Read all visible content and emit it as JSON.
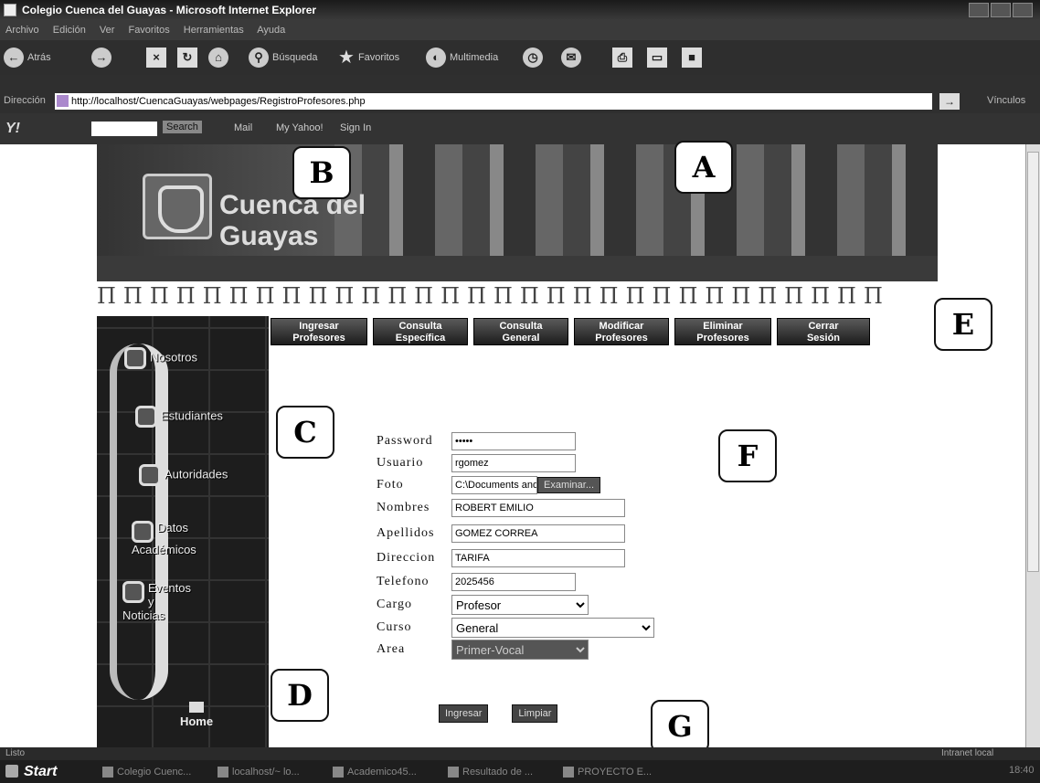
{
  "window": {
    "title": "Colegio Cuenca del Guayas - Microsoft Internet Explorer"
  },
  "menu": [
    "Archivo",
    "Edición",
    "Ver",
    "Favoritos",
    "Herramientas",
    "Ayuda"
  ],
  "toolbar": {
    "back": "Atrás",
    "search": "Búsqueda",
    "favorites": "Favoritos",
    "media": "Multimedia"
  },
  "address": {
    "label": "Dirección",
    "url": "http://localhost/CuencaGuayas/webpages/RegistroProfesores.php",
    "links": "Vínculos"
  },
  "yahoo": {
    "logo": "Y!",
    "search": "Search",
    "mail": "Mail",
    "my_yahoo": "My Yahoo!",
    "sign_in": "Sign In"
  },
  "banner": {
    "title_line1": "Cuenca del",
    "title_line2": "Guayas"
  },
  "ornaments": "ΠΠΠΠΠΠΠΠΠΠΠΠΠΠΠΠΠΠΠΠΠΠΠΠΠΠΠΠΠΠ",
  "nav": [
    {
      "l1": "Ingresar",
      "l2": "Profesores"
    },
    {
      "l1": "Consulta",
      "l2": "Específica"
    },
    {
      "l1": "Consulta",
      "l2": "General"
    },
    {
      "l1": "Modificar",
      "l2": "Profesores"
    },
    {
      "l1": "Eliminar",
      "l2": "Profesores"
    },
    {
      "l1": "Cerrar",
      "l2": "Sesión"
    }
  ],
  "sidebar": {
    "items": [
      {
        "label": "Nosotros"
      },
      {
        "label": "Estudiantes"
      },
      {
        "label": "Autoridades"
      },
      {
        "label1": "Datos",
        "label2": "Académicos"
      },
      {
        "label1": "Eventos",
        "label2": "y Noticias"
      }
    ],
    "home": "Home"
  },
  "form": {
    "password": {
      "label": "Password",
      "value": "•••••"
    },
    "usuario": {
      "label": "Usuario",
      "value": "rgomez"
    },
    "foto": {
      "label": "Foto",
      "value": "C:\\Documents and Setti",
      "browse": "Examinar..."
    },
    "nombres": {
      "label": "Nombres",
      "value": "ROBERT EMILIO"
    },
    "apellidos": {
      "label": "Apellidos",
      "value": "GOMEZ CORREA"
    },
    "direccion": {
      "label": "Direccion",
      "value": "TARIFA"
    },
    "telefono": {
      "label": "Telefono",
      "value": "2025456"
    },
    "cargo": {
      "label": "Cargo",
      "value": "Profesor"
    },
    "curso": {
      "label": "Curso",
      "value": "General"
    },
    "area": {
      "label": "Area",
      "value": "Primer-Vocal"
    },
    "ingresar": "Ingresar",
    "limpiar": "Limpiar"
  },
  "callouts": [
    "A",
    "B",
    "C",
    "D",
    "E",
    "F",
    "G"
  ],
  "status": {
    "left": "Listo",
    "right": "Intranet local"
  },
  "taskbar": {
    "start": "Start",
    "tasks": [
      "Colegio Cuenc...",
      "localhost/~ lo...",
      "Academico45...",
      "Resultado de ...",
      "PROYECTO E..."
    ],
    "clock": "18:40"
  }
}
